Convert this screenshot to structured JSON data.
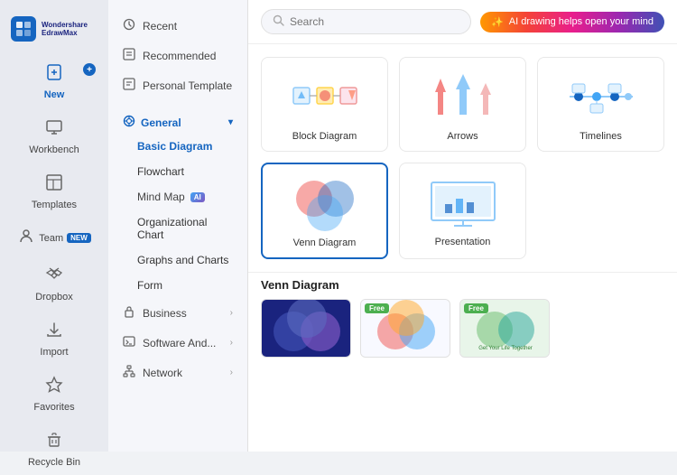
{
  "app": {
    "logo_line1": "Wondershare",
    "logo_line2": "EdrawMax"
  },
  "sidebar": {
    "items": [
      {
        "id": "new",
        "label": "New",
        "icon": "➕"
      },
      {
        "id": "workbench",
        "label": "Workbench",
        "icon": "🖥"
      },
      {
        "id": "templates",
        "label": "Templates",
        "icon": "📄"
      },
      {
        "id": "team",
        "label": "Team",
        "icon": "👤",
        "badge": "NEW"
      },
      {
        "id": "dropbox",
        "label": "Dropbox",
        "icon": "📦"
      },
      {
        "id": "import",
        "label": "Import",
        "icon": "⬇"
      },
      {
        "id": "favorites",
        "label": "Favorites",
        "icon": "⭐"
      },
      {
        "id": "recycle",
        "label": "Recycle Bin",
        "icon": "🗑"
      }
    ]
  },
  "middle": {
    "recent_label": "Recent",
    "recommended_label": "Recommended",
    "personal_label": "Personal Template",
    "general_label": "General",
    "basic_diagram_label": "Basic Diagram",
    "flowchart_label": "Flowchart",
    "mind_map_label": "Mind Map",
    "org_chart_label": "Organizational Chart",
    "graphs_label": "Graphs and Charts",
    "form_label": "Form",
    "business_label": "Business",
    "software_label": "Software And...",
    "network_label": "Network"
  },
  "search": {
    "placeholder": "Search"
  },
  "ai_banner": {
    "text": "AI drawing helps open your mind"
  },
  "diagrams": [
    {
      "id": "block",
      "label": "Block Diagram"
    },
    {
      "id": "arrows",
      "label": "Arrows"
    },
    {
      "id": "timelines",
      "label": "Timelines"
    },
    {
      "id": "venn",
      "label": "Venn Diagram",
      "selected": true
    },
    {
      "id": "presentation",
      "label": "Presentation"
    }
  ],
  "bottom": {
    "section_title": "Venn Diagram",
    "templates": [
      {
        "id": "t1",
        "free": true
      },
      {
        "id": "t2",
        "free": true
      },
      {
        "id": "t3",
        "free": false
      }
    ]
  }
}
